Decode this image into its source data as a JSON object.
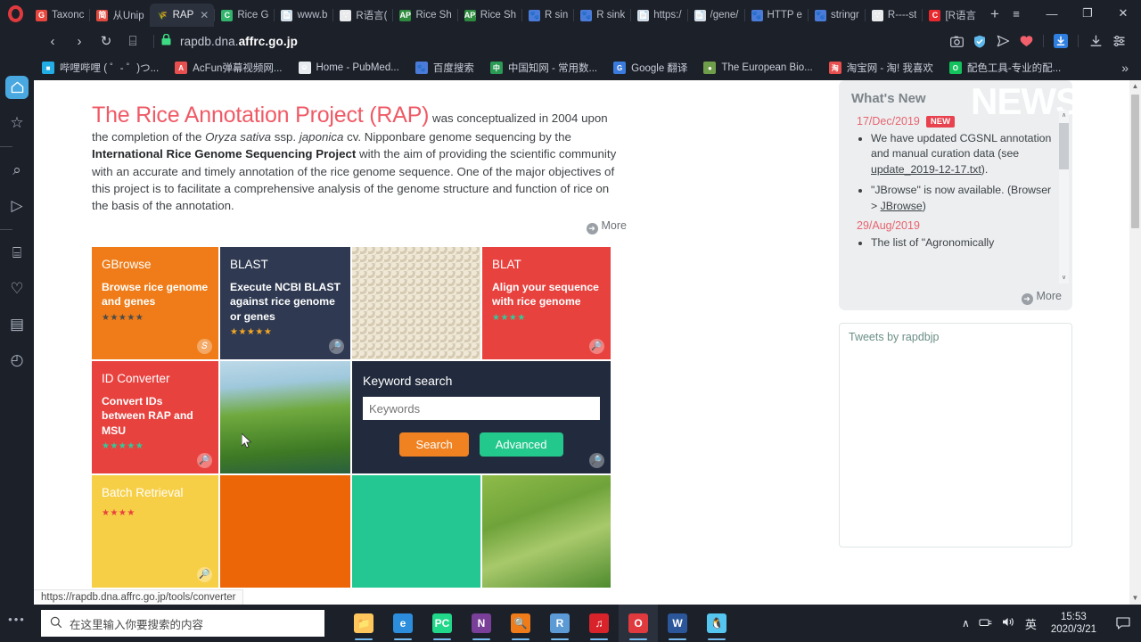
{
  "browser": {
    "tabs": [
      {
        "label": "Taxonc",
        "icon": "google-favicon",
        "glyph": "G",
        "color": "#e8453c",
        "active": false
      },
      {
        "label": "从Unip",
        "icon": "uniprot-favicon",
        "glyph": "简",
        "color": "#e04a3f",
        "active": false
      },
      {
        "label": "RAP",
        "icon": "rapdb-favicon",
        "glyph": "🌾",
        "color": "#2b313d",
        "active": true
      },
      {
        "label": "Rice G",
        "icon": "rice-favicon",
        "glyph": "C",
        "color": "#33b36b",
        "active": false
      },
      {
        "label": "www.b",
        "icon": "page-favicon",
        "glyph": "📄",
        "color": "#d8dde3",
        "active": false
      },
      {
        "label": "R语言(",
        "icon": "zhihu-favicon",
        "glyph": "∵",
        "color": "#e8eaec",
        "active": false
      },
      {
        "label": "Rice Sh",
        "icon": "aps-favicon",
        "glyph": "APS",
        "color": "#2e8b3d",
        "active": false
      },
      {
        "label": "Rice Sh",
        "icon": "aps-favicon",
        "glyph": "APS",
        "color": "#2e8b3d",
        "active": false
      },
      {
        "label": "R sin",
        "icon": "baidu-favicon",
        "glyph": "🐾",
        "color": "#4b7bd8",
        "active": false
      },
      {
        "label": "R sink",
        "icon": "baidu-favicon",
        "glyph": "🐾",
        "color": "#4b7bd8",
        "active": false
      },
      {
        "label": "https:/",
        "icon": "page-favicon",
        "glyph": "📄",
        "color": "#d8dde3",
        "active": false
      },
      {
        "label": "/gene/",
        "icon": "page-favicon",
        "glyph": "📄",
        "color": "#d8dde3",
        "active": false
      },
      {
        "label": "HTTP e",
        "icon": "baidu-favicon",
        "glyph": "🐾",
        "color": "#4b7bd8",
        "active": false
      },
      {
        "label": "stringr",
        "icon": "baidu-favicon",
        "glyph": "🐾",
        "color": "#4b7bd8",
        "active": false
      },
      {
        "label": "R----st",
        "icon": "zhihu-favicon",
        "glyph": "∵",
        "color": "#e8eaec",
        "active": false
      },
      {
        "label": "[R语言",
        "icon": "csdn-favicon",
        "glyph": "C",
        "color": "#e8282d",
        "active": false
      }
    ],
    "new_tab_label": "+",
    "window_controls": {
      "tab_menu": "≡",
      "minimize": "—",
      "maximize": "❐",
      "close": "✕"
    },
    "toolbar": {
      "back": "‹",
      "forward": "›",
      "reload": "↻",
      "tabs_overview": "⌸",
      "lock": "🔒",
      "url_prefix": "rapdb.dna.",
      "url_domain": "affrc.go.jp",
      "url_full": "rapdb.dna.affrc.go.jp",
      "right_icons": [
        {
          "name": "snapshot-icon",
          "glyph": "📷"
        },
        {
          "name": "vpn-shield-icon",
          "glyph": "✔"
        },
        {
          "name": "send-to-device-icon",
          "glyph": "➤"
        },
        {
          "name": "heart-icon",
          "glyph": "♥"
        },
        {
          "name": "downloads-active-icon",
          "glyph": "⬇"
        },
        {
          "name": "downloads-icon",
          "glyph": "⤓"
        },
        {
          "name": "easy-setup-icon",
          "glyph": "☲"
        }
      ]
    },
    "bookmarks": [
      {
        "label": "哔哩哔哩 ( ゜- ゜)つ...",
        "icon": "bilibili-icon",
        "glyph": "■",
        "color": "#23ade5"
      },
      {
        "label": "AcFun弹幕视频网...",
        "icon": "acfun-icon",
        "glyph": "A",
        "color": "#e8504f"
      },
      {
        "label": "Home - PubMed...",
        "icon": "pubmed-icon",
        "glyph": "⎉",
        "color": "#e7ecf1"
      },
      {
        "label": "百度搜索",
        "icon": "baidu-icon",
        "glyph": "🐾",
        "color": "#4b7bd8"
      },
      {
        "label": "中国知网 - 常用数...",
        "icon": "cnki-icon",
        "glyph": "中",
        "color": "#2a9a55"
      },
      {
        "label": "Google 翻译",
        "icon": "google-translate-icon",
        "glyph": "G",
        "color": "#3a7bdd"
      },
      {
        "label": "The European Bio...",
        "icon": "ebi-icon",
        "glyph": "●",
        "color": "#6f9e4a"
      },
      {
        "label": "淘宝网 - 淘! 我喜欢",
        "icon": "taobao-icon",
        "glyph": "淘",
        "color": "#e8504f"
      },
      {
        "label": "配色工具-专业的配...",
        "icon": "color-tool-icon",
        "glyph": "O",
        "color": "#13c25c"
      }
    ],
    "bookmarks_overflow": "»",
    "sidebar_rail": [
      {
        "name": "sidebar-home",
        "glyph": "⌂",
        "selected": true
      },
      {
        "name": "sidebar-speed-dial",
        "glyph": "☆",
        "selected": false
      },
      {
        "name": "sidebar-search",
        "glyph": "⌕",
        "selected": false
      },
      {
        "name": "sidebar-messenger",
        "glyph": "▷",
        "selected": false
      },
      {
        "name": "sidebar-workspaces",
        "glyph": "⌸",
        "selected": false
      },
      {
        "name": "sidebar-favorites",
        "glyph": "♡",
        "selected": false
      },
      {
        "name": "sidebar-news",
        "glyph": "▤",
        "selected": false
      },
      {
        "name": "sidebar-history",
        "glyph": "◴",
        "selected": false
      }
    ],
    "sidebar_more": "•••",
    "status_bar_url": "https://rapdb.dna.affrc.go.jp/tools/converter"
  },
  "page": {
    "intro": {
      "title": "The Rice Annotation Project (RAP)",
      "text_part1": " was conceptualized in 2004 upon the completion of the ",
      "species_italic_1": "Oryza sativa",
      "text_ssp": " ssp. ",
      "species_italic_2": "japonica",
      "text_cv": " cv.  Nipponbare genome sequencing by the ",
      "bold_org": "International Rice Genome Sequencing Project",
      "text_part2": "  with the aim of providing the scientific community with an accurate and timely annotation of the rice genome sequence. One of the major objectives of this project is to facilitate a comprehensive analysis of the genome structure and function of rice on the basis of the annotation.",
      "more_label": "More"
    },
    "tiles": [
      {
        "name": "gbrowse",
        "title": "GBrowse",
        "desc": "Browse rice genome and genes",
        "stars": 5,
        "bg": "#ef7c18",
        "star_color": "#4a4a4a",
        "corner": "𝑆",
        "type": "text"
      },
      {
        "name": "blast",
        "title": "BLAST",
        "desc": "Execute NCBI BLAST against rice genome or genes",
        "stars": 5,
        "bg": "#2f3a52",
        "star_color": "#f5a623",
        "corner": "🔎",
        "type": "text"
      },
      {
        "name": "rice-grain-photo",
        "title": "",
        "desc": "",
        "stars": 0,
        "bg": "#cfc7b2",
        "star_color": "",
        "corner": "",
        "type": "photo-grain"
      },
      {
        "name": "blat",
        "title": "BLAT",
        "desc": "Align your sequence with rice genome",
        "stars": 4,
        "bg": "#e8423f",
        "star_color": "#2ecc9b",
        "corner": "🔎",
        "type": "text"
      },
      {
        "name": "id-converter",
        "title": "ID Converter",
        "desc": "Convert IDs between RAP and MSU",
        "stars": 5,
        "bg": "#e8423f",
        "star_color": "#2ecc9b",
        "corner": "🔎",
        "type": "text"
      },
      {
        "name": "rice-field-photo",
        "title": "",
        "desc": "",
        "stars": 0,
        "bg": "#6aa84f",
        "star_color": "",
        "corner": "",
        "type": "photo-field"
      },
      {
        "name": "keyword-search",
        "type": "search"
      },
      {
        "name": "batch-retrieval",
        "title": "Batch Retrieval",
        "desc": "",
        "stars": 4,
        "bg": "#f7cf46",
        "star_color": "#e8423f",
        "corner": "🔎",
        "type": "text"
      },
      {
        "name": "orange-block",
        "title": "",
        "desc": "",
        "stars": 0,
        "bg": "#ec6608",
        "star_color": "",
        "corner": "",
        "type": "plain"
      },
      {
        "name": "teal-block",
        "title": "",
        "desc": "",
        "stars": 0,
        "bg": "#24c791",
        "star_color": "",
        "corner": "",
        "type": "plain"
      },
      {
        "name": "rice-panicle-photo",
        "title": "",
        "desc": "",
        "stars": 0,
        "bg": "#7aa93c",
        "star_color": "",
        "corner": "",
        "type": "photo-panicle"
      }
    ],
    "keyword_search": {
      "title": "Keyword search",
      "placeholder": "Keywords",
      "value": "",
      "search_label": "Search",
      "advanced_label": "Advanced",
      "search_color": "#f08221",
      "advanced_color": "#23c88c",
      "corner": "🔎"
    },
    "whats_new": {
      "title": "What's New",
      "watermark": "NEWS",
      "entries": [
        {
          "date": "17/Dec/2019",
          "badge": "NEW",
          "items": [
            {
              "pre": "We have updated CGSNL annotation and manual curation data (see ",
              "link": "update_2019-12-17.txt",
              "post": ")."
            },
            {
              "pre": "\"JBrowse\" is now available. (Browser > ",
              "link": "JBrowse",
              "post": ")"
            }
          ]
        },
        {
          "date": "29/Aug/2019",
          "badge": "",
          "items": [
            {
              "pre": "The list of \"Agronomically",
              "link": "",
              "post": ""
            }
          ]
        }
      ],
      "more_label": "More",
      "scroll_up": "∧",
      "scroll_down": "∨"
    },
    "tweets": {
      "label": "Tweets by rapdbjp"
    }
  },
  "taskbar": {
    "search_placeholder": "在这里输入你要搜索的内容",
    "search_icon": "search-icon",
    "apps": [
      {
        "name": "file-explorer",
        "glyph": "📁",
        "color": "#ffc65c",
        "running": true,
        "active": false
      },
      {
        "name": "microsoft-edge",
        "glyph": "e",
        "color": "#2b8ddb",
        "running": true,
        "active": false
      },
      {
        "name": "pycharm",
        "glyph": "PC",
        "color": "#21d789",
        "running": true,
        "active": false
      },
      {
        "name": "onenote",
        "glyph": "N",
        "color": "#7a3f98",
        "running": true,
        "active": false
      },
      {
        "name": "everything-search",
        "glyph": "🔍",
        "color": "#ef7c18",
        "running": true,
        "active": false
      },
      {
        "name": "rstudio",
        "glyph": "R",
        "color": "#5b9ad5",
        "running": true,
        "active": false
      },
      {
        "name": "netease-music",
        "glyph": "♫",
        "color": "#d8232a",
        "running": true,
        "active": false
      },
      {
        "name": "opera-browser",
        "glyph": "O",
        "color": "#e03a3e",
        "running": true,
        "active": true
      },
      {
        "name": "microsoft-word",
        "glyph": "W",
        "color": "#2b579a",
        "running": true,
        "active": false
      },
      {
        "name": "qq-app",
        "glyph": "🐧",
        "color": "#55c6f0",
        "running": true,
        "active": false
      }
    ],
    "tray": {
      "chevron": "∧",
      "network": "🖧",
      "volume": "🔊",
      "ime": "英",
      "time": "15:53",
      "date": "2020/3/21",
      "notifications": "💬"
    }
  }
}
